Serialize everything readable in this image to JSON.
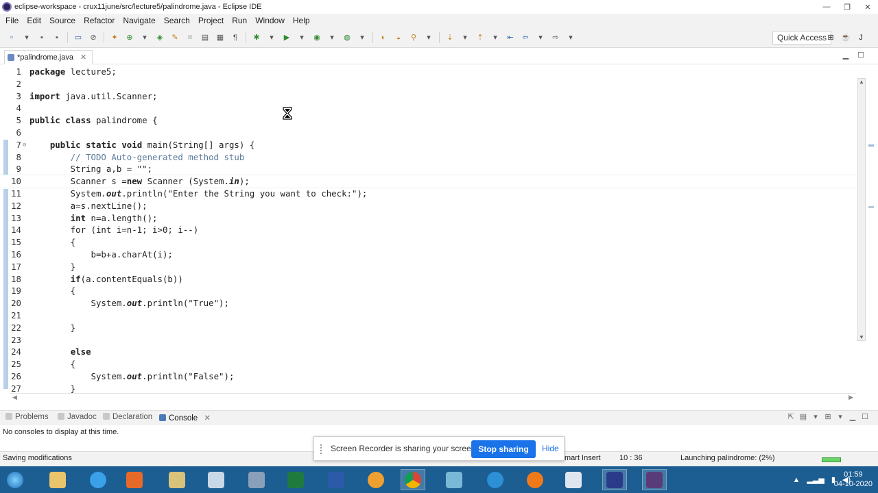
{
  "window": {
    "title": "eclipse-workspace - crux11june/src/lecture5/palindrome.java - Eclipse IDE",
    "controls": [
      "—",
      "❐",
      "✕"
    ]
  },
  "menu": [
    "File",
    "Edit",
    "Source",
    "Refactor",
    "Navigate",
    "Search",
    "Project",
    "Run",
    "Window",
    "Help"
  ],
  "toolbar": {
    "quick_access": "Quick Access"
  },
  "editor": {
    "tab_label": "*palindrome.java",
    "tab_close": "✕",
    "lines": [
      {
        "n": "1",
        "code": "package lecture5;"
      },
      {
        "n": "2",
        "code": ""
      },
      {
        "n": "3",
        "code": "import java.util.Scanner;"
      },
      {
        "n": "4",
        "code": ""
      },
      {
        "n": "5",
        "code": "public class palindrome {"
      },
      {
        "n": "6",
        "code": ""
      },
      {
        "n": "7",
        "code": "    public static void main(String[] args) {"
      },
      {
        "n": "8",
        "code": "        // TODO Auto-generated method stub"
      },
      {
        "n": "9",
        "code": "        String a,b = \"\";"
      },
      {
        "n": "10",
        "code": "        Scanner s =new Scanner (System.in);"
      },
      {
        "n": "11",
        "code": "        System.out.println(\"Enter the String you want to check:\");"
      },
      {
        "n": "12",
        "code": "        a=s.nextLine();"
      },
      {
        "n": "13",
        "code": "        int n=a.length();"
      },
      {
        "n": "14",
        "code": "        for (int i=n-1; i>0; i--)"
      },
      {
        "n": "15",
        "code": "        {"
      },
      {
        "n": "16",
        "code": "            b=b+a.charAt(i);"
      },
      {
        "n": "17",
        "code": "        }"
      },
      {
        "n": "18",
        "code": "        if(a.contentEquals(b))"
      },
      {
        "n": "19",
        "code": "        {"
      },
      {
        "n": "20",
        "code": "            System.out.println(\"True\");"
      },
      {
        "n": "21",
        "code": ""
      },
      {
        "n": "22",
        "code": "        }"
      },
      {
        "n": "23",
        "code": ""
      },
      {
        "n": "24",
        "code": "        else"
      },
      {
        "n": "25",
        "code": "        {"
      },
      {
        "n": "26",
        "code": "            System.out.println(\"False\");"
      },
      {
        "n": "27",
        "code": "        }"
      }
    ]
  },
  "bottom_panel": {
    "tabs": [
      {
        "label": "Problems",
        "active": false
      },
      {
        "label": "Javadoc",
        "active": false
      },
      {
        "label": "Declaration",
        "active": false
      },
      {
        "label": "Console",
        "active": true
      }
    ],
    "console_close": "✕",
    "console_message": "No consoles to display at this time."
  },
  "status": {
    "left": "Saving modifications",
    "insert_mode": "mart Insert",
    "position": "10 : 36",
    "launching": "Launching palindrome: (2%)",
    "launch_progress": 0.02
  },
  "share_bar": {
    "message": "Screen Recorder is sharing your screen.",
    "stop": "Stop sharing",
    "hide": "Hide"
  },
  "taskbar": {
    "time": "01:59",
    "date": "04-10-2020"
  }
}
